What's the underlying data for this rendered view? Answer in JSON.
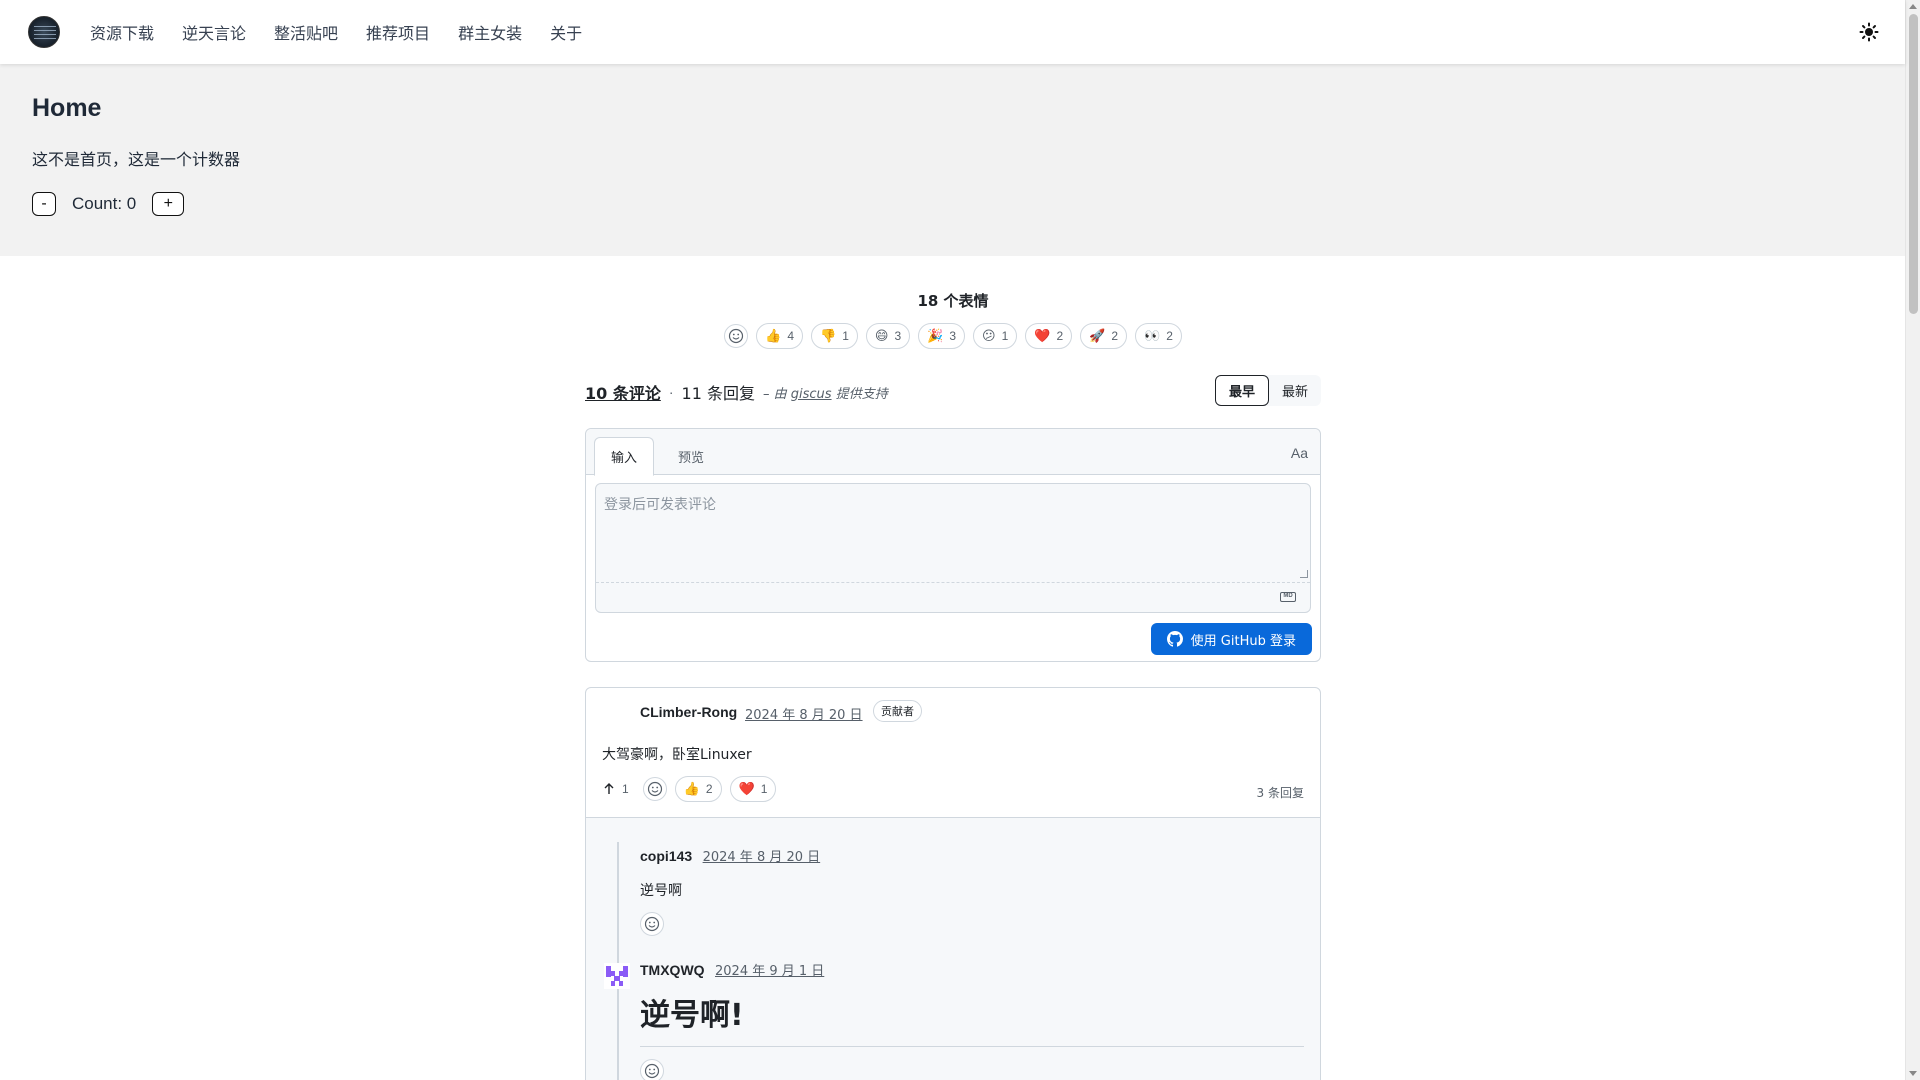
{
  "nav": {
    "items": [
      "资源下载",
      "逆天言论",
      "整活贴吧",
      "推荐项目",
      "群主女装",
      "关于"
    ]
  },
  "hero": {
    "title": "Home",
    "subtitle": "这不是首页，这是一个计数器",
    "minus_label": "-",
    "count_text": "Count: 0",
    "plus_label": "+"
  },
  "reactions": {
    "title": "18 个表情",
    "items": [
      {
        "emoji": "👍",
        "count": "4"
      },
      {
        "emoji": "👎",
        "count": "1"
      },
      {
        "emoji": "😄",
        "count": "3"
      },
      {
        "emoji": "🎉",
        "count": "3"
      },
      {
        "emoji": "😕",
        "count": "1"
      },
      {
        "emoji": "❤️",
        "count": "2"
      },
      {
        "emoji": "🚀",
        "count": "2"
      },
      {
        "emoji": "👀",
        "count": "2"
      }
    ]
  },
  "meta": {
    "comments": "10 条评论",
    "dot": "·",
    "replies": "11 条回复",
    "powered_prefix": "– 由",
    "powered_link": "giscus",
    "powered_suffix": "提供支持",
    "sort_oldest": "最早",
    "sort_newest": "最新"
  },
  "comment_box": {
    "tab_write": "输入",
    "tab_preview": "预览",
    "aa": "Aa",
    "placeholder": "登录后可发表评论",
    "md": "MD",
    "login_button": "使用 GitHub 登录"
  },
  "comment": {
    "author": "CLimber-Rong",
    "date": "2024 年 8 月 20 日",
    "badge": "贡献者",
    "body": "大驾豪啊，卧室Linuxer",
    "upvotes": "1",
    "reactions": [
      {
        "emoji": "👍",
        "count": "2"
      },
      {
        "emoji": "❤️",
        "count": "1"
      }
    ],
    "reply_count": "3 条回复",
    "replies": [
      {
        "author": "copi143",
        "date": "2024 年 8 月 20 日",
        "body": "逆号啊"
      },
      {
        "author": "TMXQWQ",
        "date": "2024 年 9 月 1 日",
        "body": "逆号啊!"
      }
    ]
  },
  "colors": {
    "accent": "#0969da",
    "hero_bg": "#f2f2f2",
    "border": "#d0d7de",
    "muted": "#57606a"
  }
}
